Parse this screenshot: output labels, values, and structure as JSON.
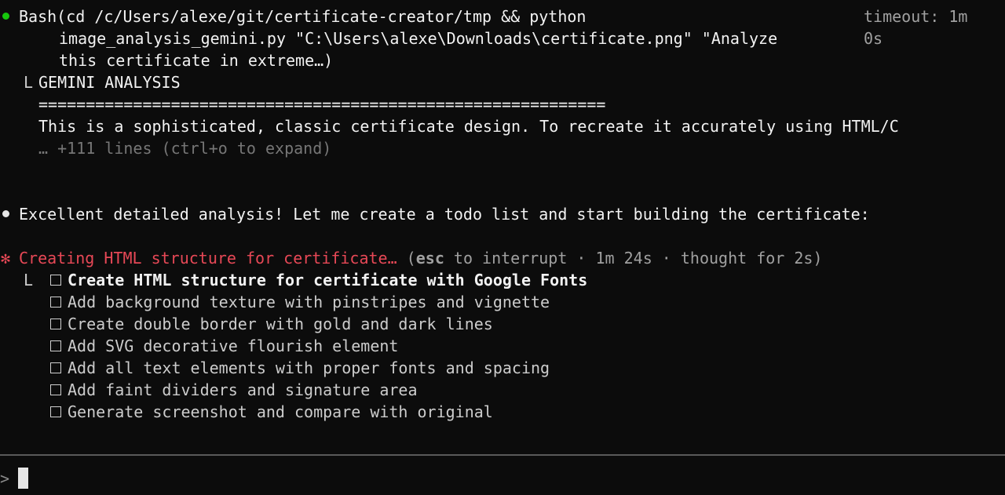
{
  "bash_call": {
    "tool_name": "Bash",
    "command_line_1": "(cd /c/Users/alexe/git/certificate-creator/tmp && python",
    "command_line_2": "image_analysis_gemini.py \"C:\\Users\\alexe\\Downloads\\certificate.png\" \"Analyze",
    "command_line_3": "this certificate in extreme…)",
    "timeout_line_1": "timeout: 1m",
    "timeout_line_2": "0s",
    "result_connector": "L",
    "result_title": "GEMINI ANALYSIS",
    "result_rule": "============================================================",
    "result_text": "This is a sophisticated, classic certificate design. To recreate it accurately using HTML/C",
    "collapsed_hint": "… +111 lines (ctrl+o to expand)"
  },
  "assistant_message": {
    "text": "Excellent detailed analysis! Let me create a todo list and start building the certificate:"
  },
  "status": {
    "spinner_glyph": "✻",
    "activity": "Creating HTML structure for certificate…",
    "open_paren": " (",
    "key": "esc",
    "details": " to interrupt · 1m 24s · thought for 2s)"
  },
  "todos": {
    "connector": "L",
    "items": [
      {
        "label": "Create HTML structure for certificate with Google Fonts",
        "active": true
      },
      {
        "label": "Add background texture with pinstripes and vignette",
        "active": false
      },
      {
        "label": "Create double border with gold and dark lines",
        "active": false
      },
      {
        "label": "Add SVG decorative flourish element",
        "active": false
      },
      {
        "label": "Add all text elements with proper fonts and spacing",
        "active": false
      },
      {
        "label": "Add faint dividers and signature area",
        "active": false
      },
      {
        "label": "Generate screenshot and compare with original",
        "active": false
      }
    ]
  },
  "prompt": {
    "caret": ">"
  },
  "colors": {
    "background": "#0c0c0c",
    "tool_dot": "#16c60c",
    "status_red": "#e74856",
    "text": "#cccccc"
  }
}
